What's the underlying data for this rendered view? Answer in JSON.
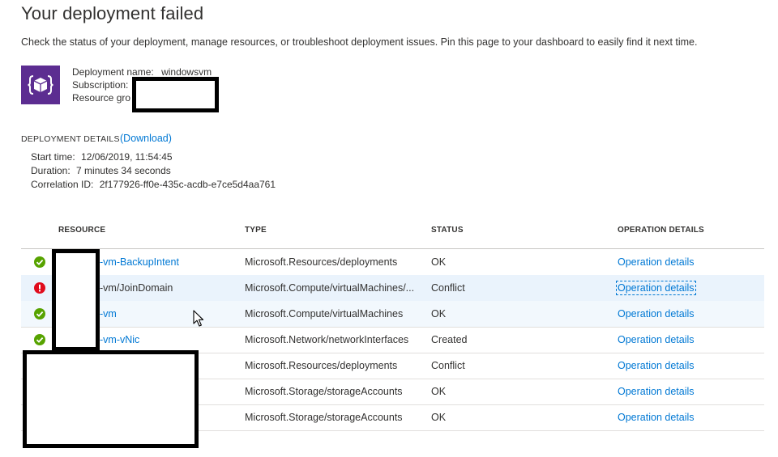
{
  "page": {
    "title": "Your deployment failed",
    "subtitle": "Check the status of your deployment, manage resources, or troubleshoot deployment issues. Pin this page to your dashboard to easily find it next time."
  },
  "summary": {
    "icon": "deployment-cube-icon",
    "deployment_name_label": "Deployment name:",
    "deployment_name_value": "windowsvm",
    "subscription_label": "Subscription:",
    "resource_group_label": "Resource gro"
  },
  "details": {
    "header": "DEPLOYMENT DETAILS",
    "download_link": "(Download)",
    "start_time_label": "Start time:",
    "start_time_value": "12/06/2019, 11:54:45",
    "duration_label": "Duration:",
    "duration_value": "7 minutes 34 seconds",
    "correlation_label": "Correlation ID:",
    "correlation_value": "2f177926-ff0e-435c-acdb-e7ce5d4aa761"
  },
  "table": {
    "headers": {
      "resource": "RESOURCE",
      "type": "TYPE",
      "status": "STATUS",
      "operation": "OPERATION DETAILS"
    },
    "rows": [
      {
        "status_icon": "success-check-icon",
        "resource": "-vm-BackupIntent",
        "type": "Microsoft.Resources/deployments",
        "status": "OK",
        "operation": "Operation details"
      },
      {
        "status_icon": "error-icon",
        "resource": "-vm/JoinDomain",
        "type": "Microsoft.Compute/virtualMachines/...",
        "status": "Conflict",
        "operation": "Operation details"
      },
      {
        "status_icon": "success-check-icon",
        "resource": "-vm",
        "type": "Microsoft.Compute/virtualMachines",
        "status": "OK",
        "operation": "Operation details"
      },
      {
        "status_icon": "success-check-icon",
        "resource": "-vm-vNic",
        "type": "Microsoft.Network/networkInterfaces",
        "status": "Created",
        "operation": "Operation details"
      },
      {
        "resource": "",
        "type": "Microsoft.Resources/deployments",
        "status": "Conflict",
        "operation": "Operation details"
      },
      {
        "resource": "",
        "type": "Microsoft.Storage/storageAccounts",
        "status": "OK",
        "operation": "Operation details"
      },
      {
        "resource": "",
        "type": "Microsoft.Storage/storageAccounts",
        "status": "OK",
        "operation": "Operation details"
      }
    ]
  },
  "colors": {
    "link": "#0078d4",
    "icon_bg": "#5c2d91",
    "success": "#57a300",
    "error": "#e00b1c",
    "row_highlight": "#eaf3fc"
  }
}
